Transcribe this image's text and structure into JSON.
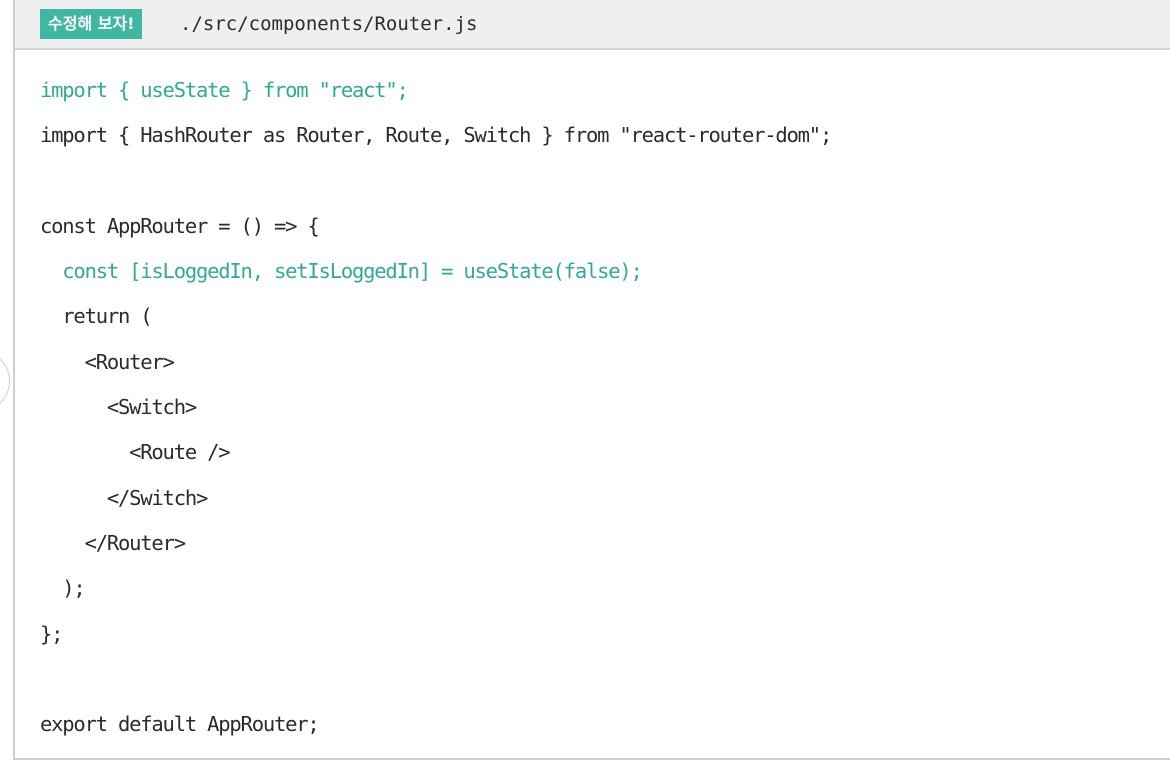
{
  "header": {
    "badge_label": "수정해 보자!",
    "file_path": "./src/components/Router.js"
  },
  "colors": {
    "accent": "#3fb7a3",
    "highlight_text": "#33a994",
    "code_text": "#2b2b2b",
    "header_bg": "#efefef",
    "border": "#cfcfcf"
  },
  "code_lines": [
    {
      "text": "import { useState } from \"react\";",
      "highlight": true
    },
    {
      "text": "import { HashRouter as Router, Route, Switch } from \"react-router-dom\";",
      "highlight": false
    },
    {
      "text": "",
      "highlight": false
    },
    {
      "text": "const AppRouter = () => {",
      "highlight": false
    },
    {
      "text": "  const [isLoggedIn, setIsLoggedIn] = useState(false);",
      "highlight": true
    },
    {
      "text": "  return (",
      "highlight": false
    },
    {
      "text": "    <Router>",
      "highlight": false
    },
    {
      "text": "      <Switch>",
      "highlight": false
    },
    {
      "text": "        <Route />",
      "highlight": false
    },
    {
      "text": "      </Switch>",
      "highlight": false
    },
    {
      "text": "    </Router>",
      "highlight": false
    },
    {
      "text": "  );",
      "highlight": false
    },
    {
      "text": "};",
      "highlight": false
    },
    {
      "text": "",
      "highlight": false
    },
    {
      "text": "export default AppRouter;",
      "highlight": false
    }
  ]
}
